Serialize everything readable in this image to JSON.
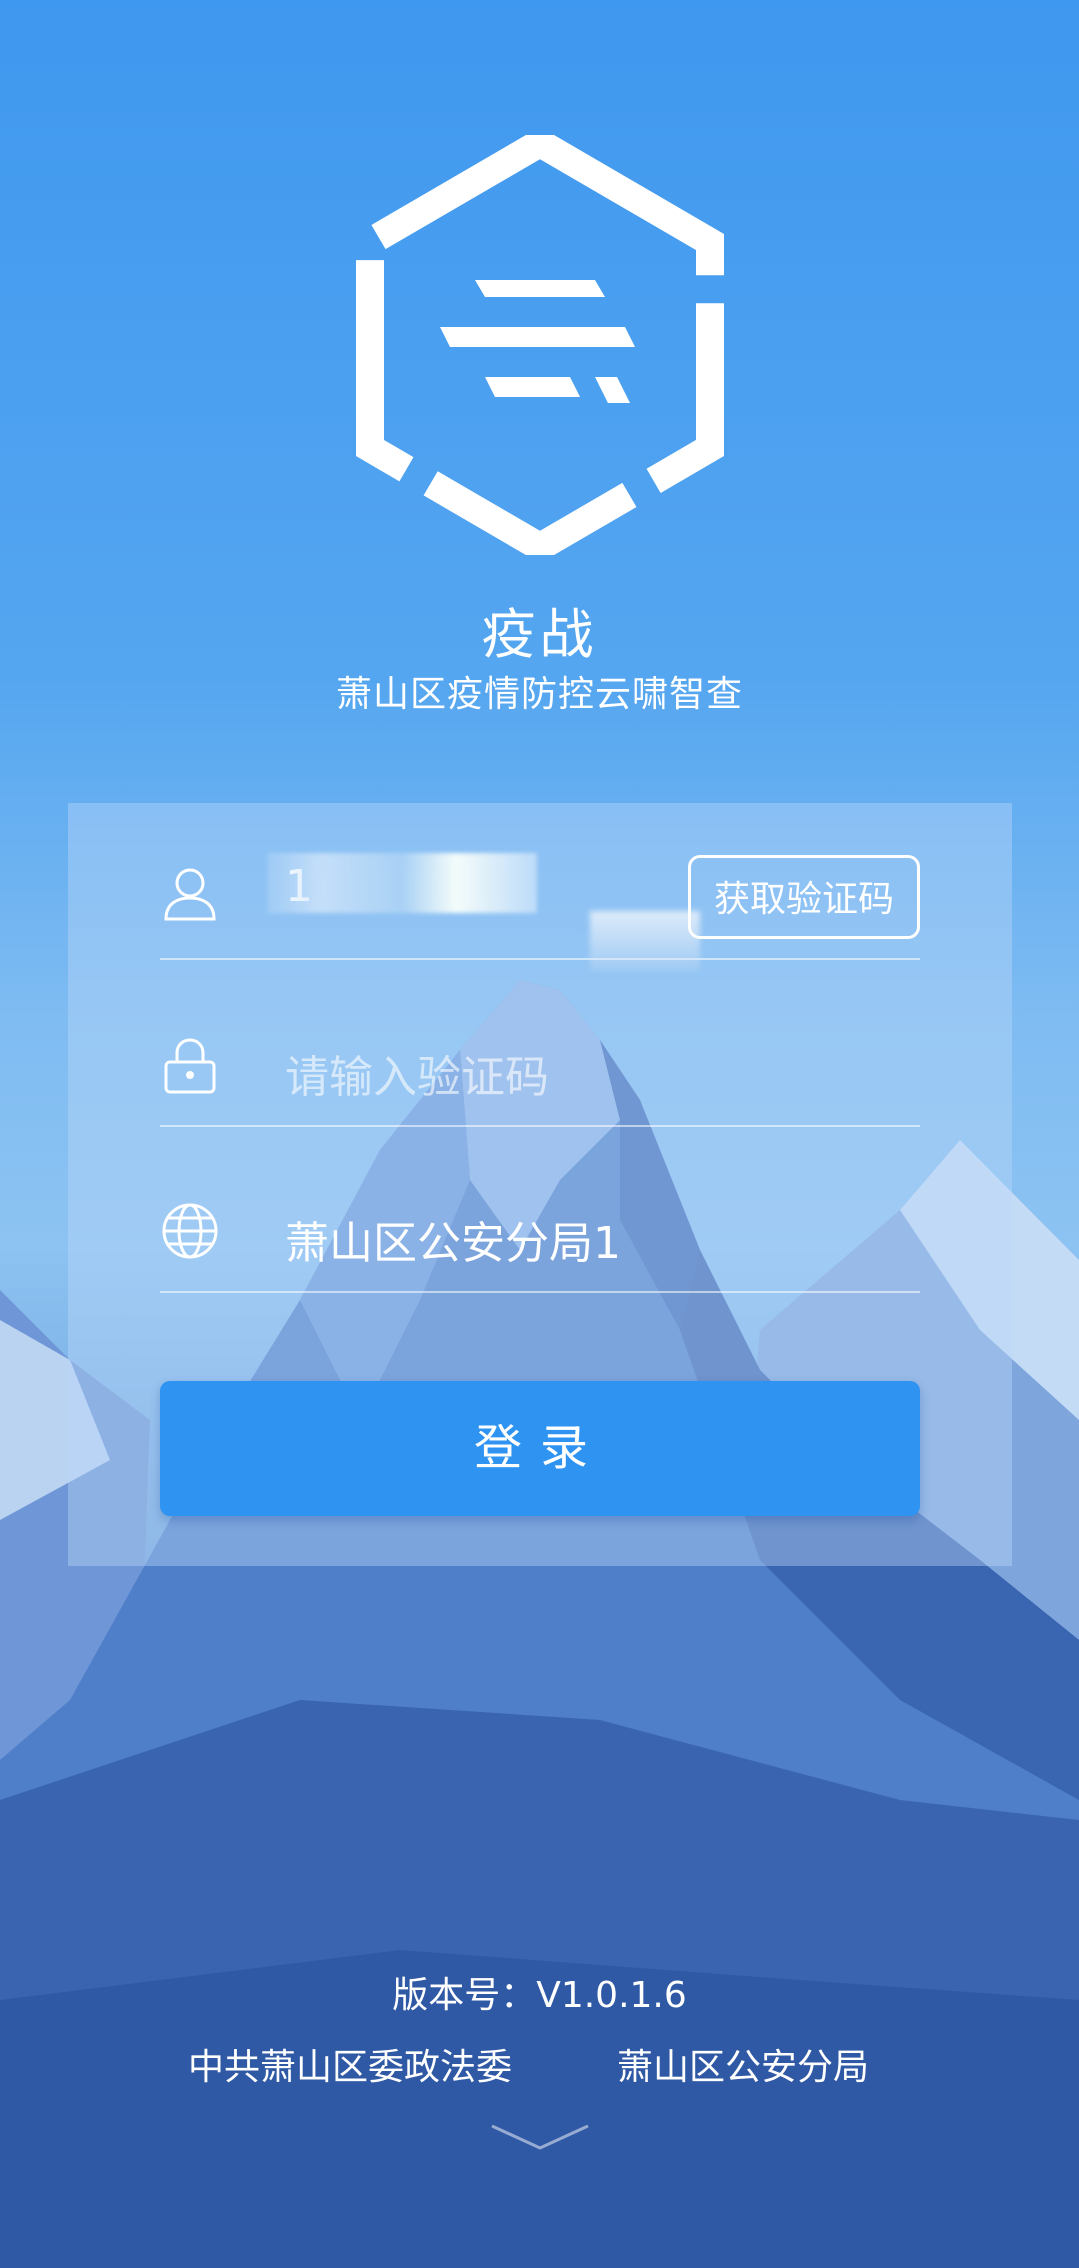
{
  "app": {
    "title": "疫战",
    "subtitle": "萧山区疫情防控云啸智查"
  },
  "login_form": {
    "phone_value": "1",
    "get_code_label": "获取验证码",
    "code_placeholder": "请输入验证码",
    "unit_value": "萧山区公安分局1",
    "login_label": "登录"
  },
  "icons": {
    "phone_row": "user-icon",
    "code_row": "lock-icon",
    "unit_row": "globe-icon",
    "footer": "chevron-down-icon"
  },
  "footer": {
    "version": "版本号：V1.0.1.6",
    "org_left": "中共萧山区委政法委",
    "org_right": "萧山区公安分局"
  },
  "colors": {
    "accent": "#2f93f2",
    "background_top": "#3f98ef",
    "background_bottom": "#2f5aa9"
  }
}
